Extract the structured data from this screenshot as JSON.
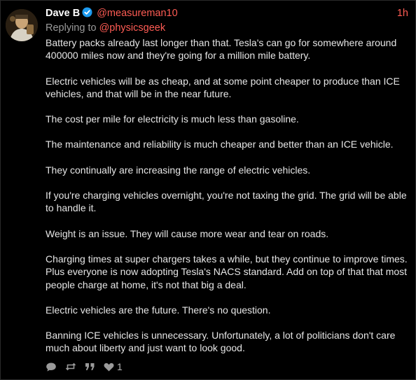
{
  "post": {
    "author_name": "Dave B",
    "author_handle": "@measureman10",
    "timestamp": "1h",
    "reply_prefix": "Replying to",
    "reply_to": "@physicsgeek",
    "paragraphs": [
      "Battery packs already last longer than that. Tesla's can go for somewhere around 400000 miles now and they're going for a million mile battery.",
      "Electric vehicles will be as cheap, and at some point cheaper to produce than ICE vehicles, and that will be in the near future.",
      "The cost per mile for electricity is much less than gasoline.",
      "The maintenance and reliability is much cheaper and better than an ICE vehicle.",
      "They continually are increasing the range of electric vehicles.",
      "If you're charging vehicles overnight, you're not taxing the grid. The grid will be able to handle it.",
      "Weight is an issue. They will cause more wear and tear on roads.",
      "Charging times at super chargers takes a while, but they continue to improve times. Plus everyone is now adopting Tesla's NACS standard. Add on top of that that most people charge at home, it's not that big a deal.",
      "Electric vehicles are the future. There's no question.",
      "Banning ICE vehicles is unnecessary. Unfortunately, a lot of politicians don't care much about liberty and just want to look good."
    ],
    "like_count": "1"
  },
  "icons": {
    "verified": "verified-badge-icon",
    "reply": "speech-bubble-icon",
    "repost": "repost-icon",
    "quote": "quote-icon",
    "like": "heart-icon"
  },
  "colors": {
    "background": "#000000",
    "accent": "#ff5c54",
    "verified": "#1d9bf0",
    "muted": "#9a9a9a",
    "text": "#e6e6e6"
  }
}
